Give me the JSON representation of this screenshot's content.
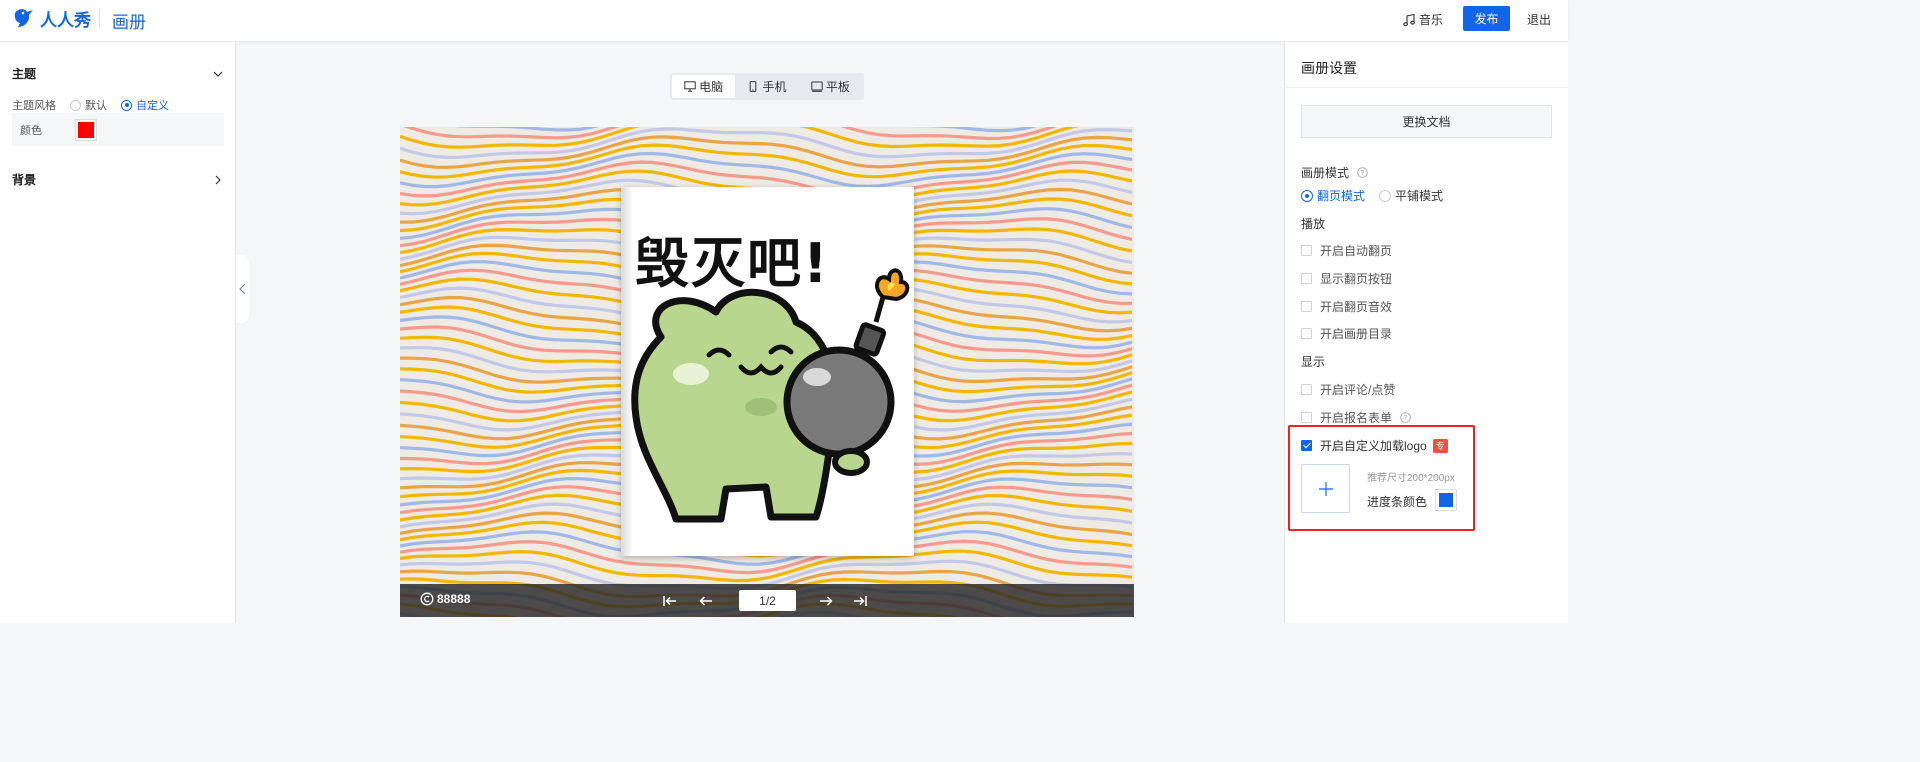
{
  "header": {
    "logo_text": "人人秀",
    "app_title": "画册",
    "music_label": "音乐",
    "publish_label": "发布",
    "logout_label": "退出"
  },
  "left_panel": {
    "theme_section": "主题",
    "theme_style_label": "主题风格",
    "theme_options": [
      "默认",
      "自定义"
    ],
    "theme_selected": "自定义",
    "color_label": "颜色",
    "theme_color": "#ff0000",
    "background_section": "背景"
  },
  "center": {
    "device_tabs": [
      "电脑",
      "手机",
      "平板"
    ],
    "device_selected": "电脑",
    "sticker_text": "毁灭吧!",
    "brand_text": "88888",
    "page_indicator": "1/2"
  },
  "right_panel": {
    "title": "画册设置",
    "replace_doc_label": "更换文档",
    "album_mode_label": "画册模式",
    "mode_options": [
      "翻页模式",
      "平铺模式"
    ],
    "mode_selected": "翻页模式",
    "play_section": "播放",
    "play_options": [
      {
        "label": "开启自动翻页",
        "checked": false
      },
      {
        "label": "显示翻页按钮",
        "checked": false
      },
      {
        "label": "开启翻页音效",
        "checked": false
      },
      {
        "label": "开启画册目录",
        "checked": false
      }
    ],
    "display_section": "显示",
    "display_options": [
      {
        "label": "开启评论/点赞",
        "checked": false
      },
      {
        "label": "开启报名表单",
        "checked": false
      }
    ],
    "custom_logo": {
      "label": "开启自定义加载logo",
      "checked": true,
      "badge": "专"
    },
    "recommended_size": "推荐尺寸200*200px",
    "progress_color_label": "进度条颜色",
    "progress_color": "#1166e8"
  },
  "colors": {
    "accent": "#1166e8",
    "highlight": "#e8241f",
    "badge": "#f0503c"
  }
}
